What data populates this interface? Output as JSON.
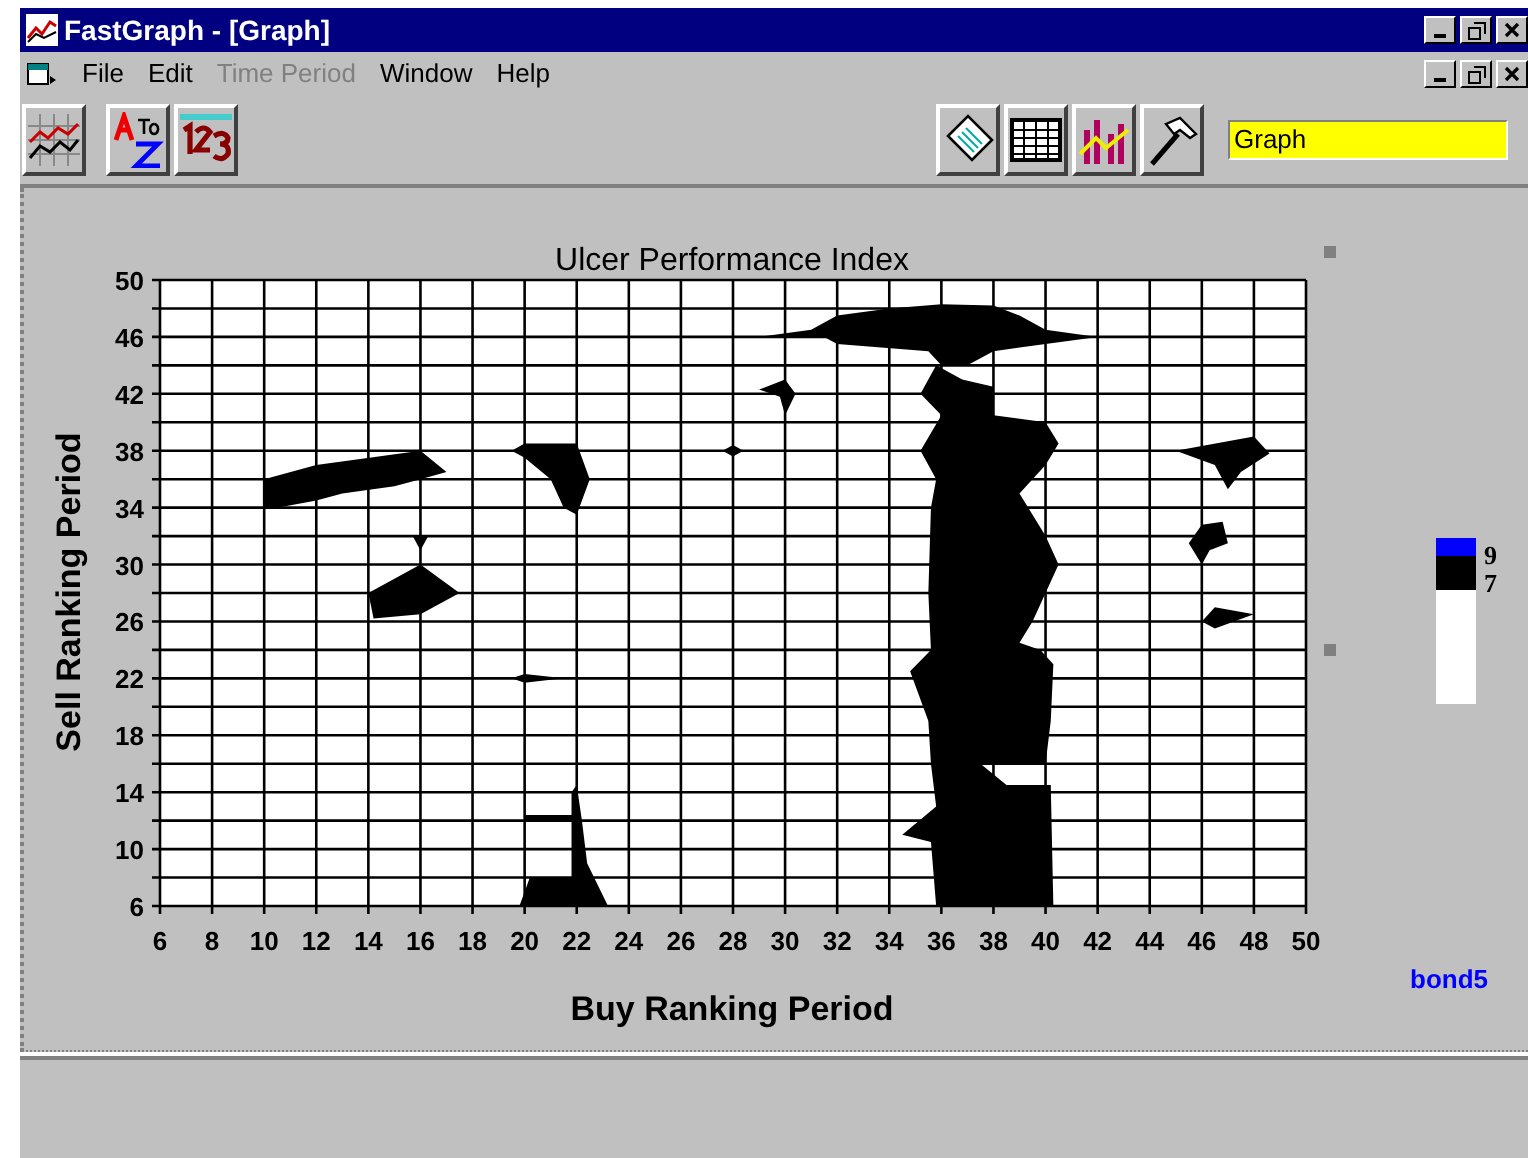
{
  "window": {
    "title": "FastGraph - [Graph]"
  },
  "menu": [
    {
      "label": "File",
      "disabled": false
    },
    {
      "label": "Edit",
      "disabled": false
    },
    {
      "label": "Time Period",
      "disabled": true
    },
    {
      "label": "Window",
      "disabled": false
    },
    {
      "label": "Help",
      "disabled": false
    }
  ],
  "toolbar": {
    "field": {
      "value": "Graph"
    }
  },
  "chart": {
    "title": "Ulcer Performance Index",
    "xlabel": "Buy Ranking Period",
    "ylabel": "Sell Ranking Period",
    "xticks": [
      "6",
      "8",
      "10",
      "12",
      "14",
      "16",
      "18",
      "20",
      "22",
      "24",
      "26",
      "28",
      "30",
      "32",
      "34",
      "36",
      "38",
      "40",
      "42",
      "44",
      "46",
      "48",
      "50"
    ],
    "yticks": [
      "50",
      "46",
      "42",
      "38",
      "34",
      "30",
      "26",
      "22",
      "18",
      "14",
      "10",
      "6"
    ]
  },
  "legend": [
    {
      "label": "9",
      "color": "#0000ff"
    },
    {
      "label": "7",
      "color": "#000000"
    }
  ],
  "series_name": "bond5"
}
